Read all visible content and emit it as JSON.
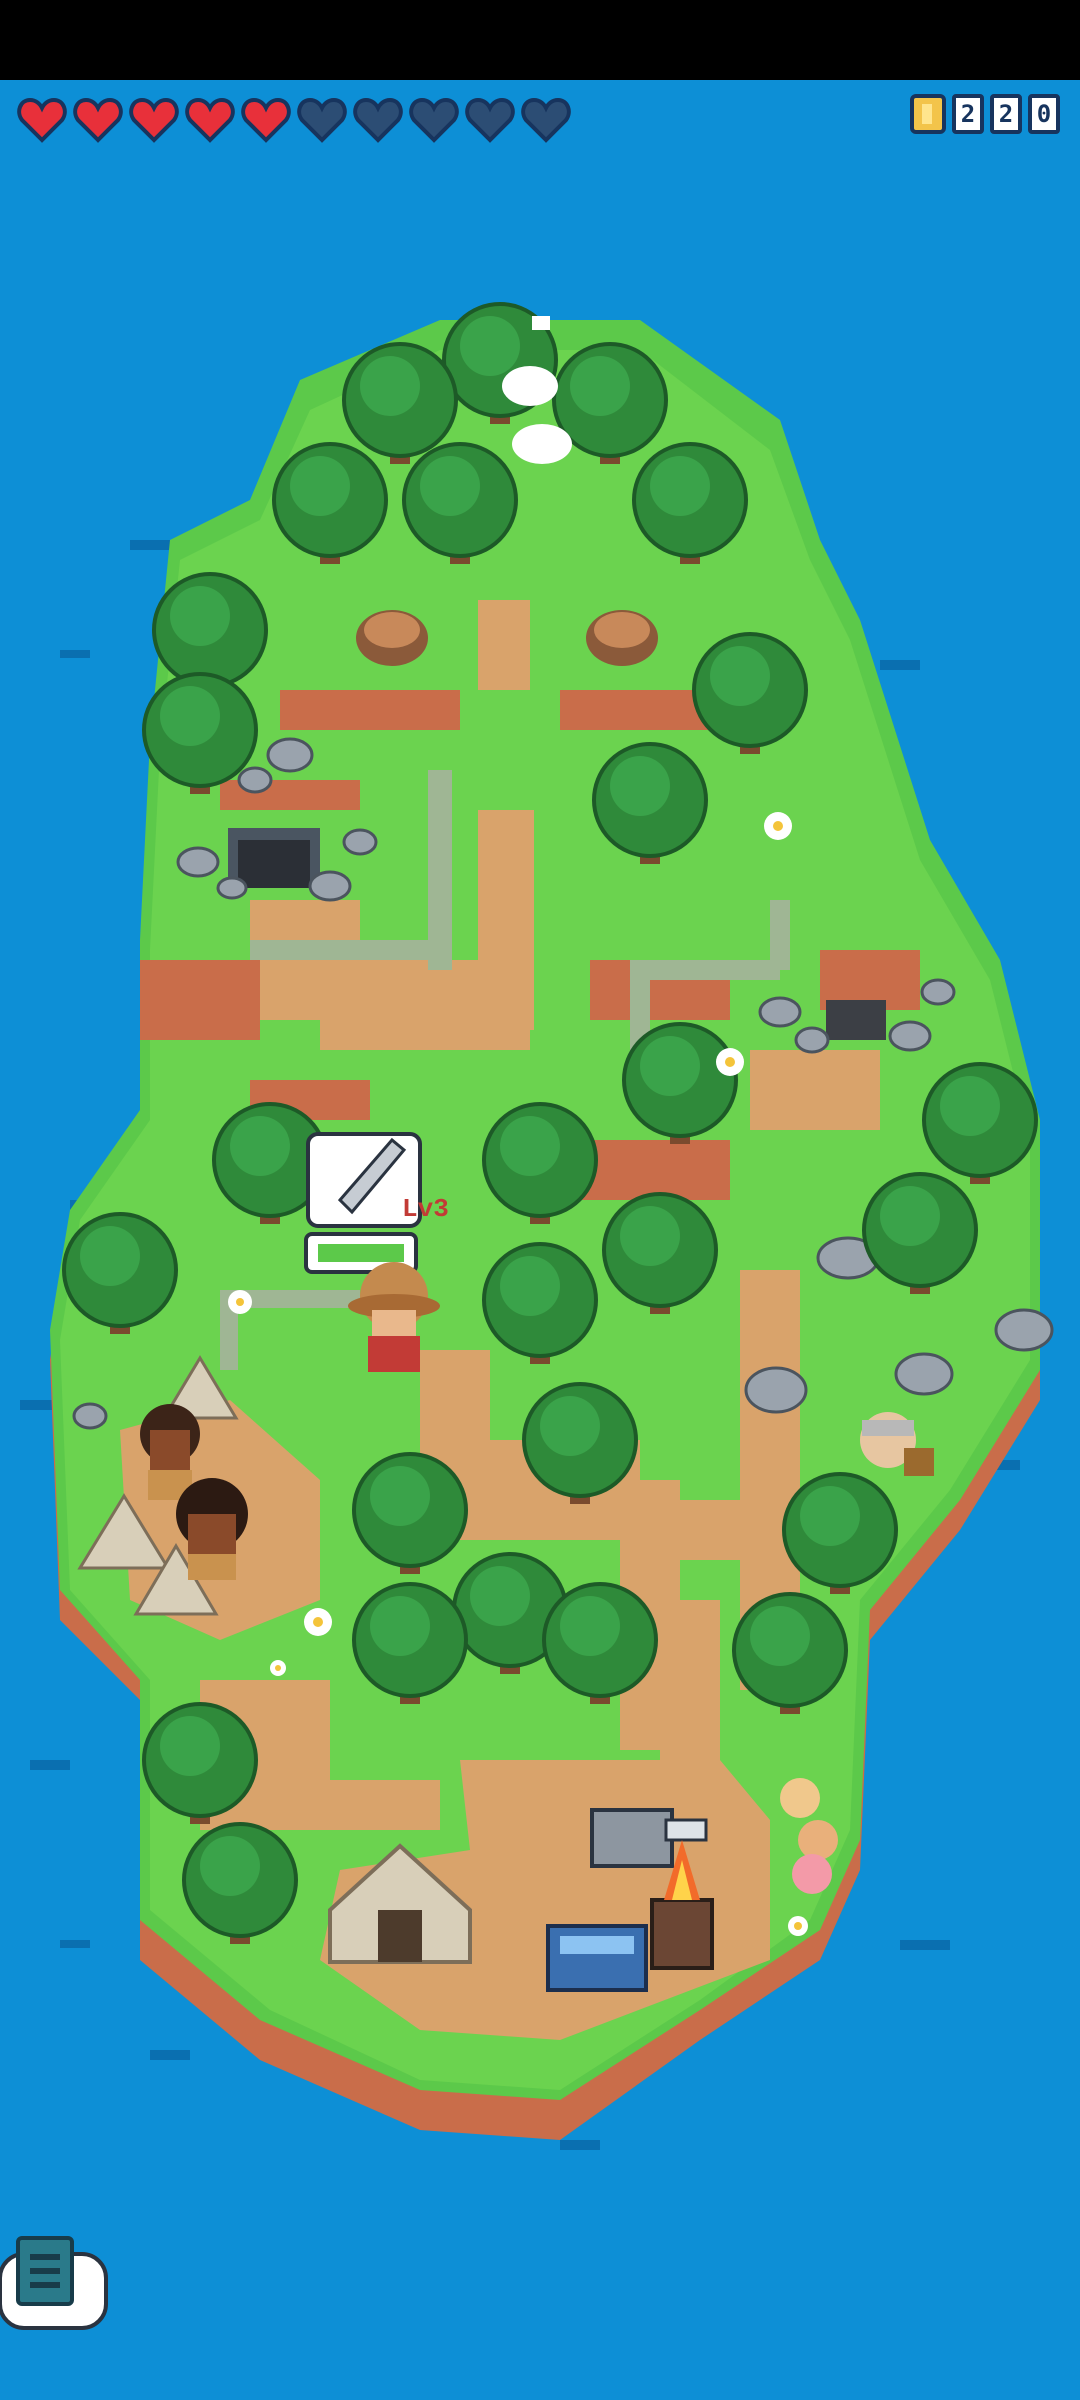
{
  "hud": {
    "hearts": {
      "filled": 5,
      "total": 10,
      "filled_color": "#e8303a",
      "empty_color": "#2c4d74"
    },
    "coins": {
      "digits": [
        "2",
        "2",
        "0"
      ],
      "icon": "coin-icon"
    }
  },
  "character": {
    "level_label": "Lv3",
    "icon": "sword-icon"
  },
  "menu": {
    "icon": "journal-icon"
  },
  "colors": {
    "ocean": "#0d8fd6",
    "grass": "#5cc94a",
    "path": "#d9a36b",
    "cliff": "#c96d4a",
    "tree": "#2f8a3a"
  }
}
